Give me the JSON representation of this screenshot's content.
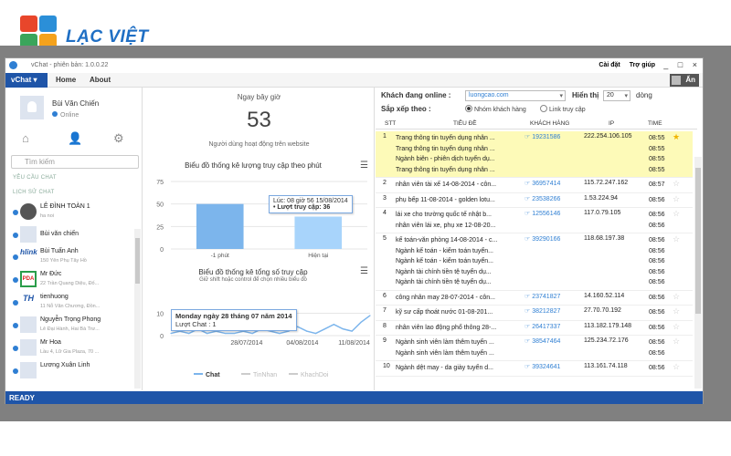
{
  "brand": {
    "logo_text": "LẠC VIỆT"
  },
  "window": {
    "title": "vChat - phiên bản: 1.0.0.22",
    "links": [
      "Cài đặt",
      "Trợ giúp"
    ],
    "controls": [
      "_",
      "□",
      "×"
    ]
  },
  "menu": {
    "vchat": "vChat",
    "items": [
      "Home",
      "About"
    ],
    "right_button": "Ẩn"
  },
  "profile": {
    "name": "Bùi Văn Chiến",
    "status": "Online"
  },
  "search": {
    "placeholder": "Tìm kiếm"
  },
  "sections": {
    "yeu_cau": "YÊU CẦU CHAT",
    "lich_su": "LỊCH SỬ CHAT"
  },
  "contacts": [
    {
      "name": "LÊ ĐÌNH TOÀN 1",
      "sub": "ha noi"
    },
    {
      "name": "Bùi văn chiến",
      "sub": ""
    },
    {
      "name": "Bùi Tuấn Anh",
      "sub": "150 Yên Phụ Tây Hồ"
    },
    {
      "name": "Mr Đức",
      "sub": "22 Trần Quang Diệu, Đố..."
    },
    {
      "name": "tienhuong",
      "sub": "11 Nỗ Văn Chương, Đồn..."
    },
    {
      "name": "Nguyễn Trọng Phong",
      "sub": "Lê Đại Hành, Hai Bà Trư..."
    },
    {
      "name": "Mr Hoa",
      "sub": "Lầu 4, Lữ Gia Plaza, 70 ..."
    },
    {
      "name": "Lương Xuân Linh",
      "sub": ""
    }
  ],
  "stats": {
    "today_label": "Ngay bây giờ",
    "count": "53",
    "count_caption": "Người dùng hoạt động trên website"
  },
  "chart1": {
    "title": "Biểu đồ thống kê lượng truy cập theo phút",
    "tooltip_line1": "Lúc: 08 giờ 56 15/08/2014",
    "tooltip_line2": "• Lượt truy cập: 36"
  },
  "chart2": {
    "title": "Biểu đồ thống kê tổng số truy cập",
    "subtitle": "Giữ shift hoặc control để chọn nhiều biểu đồ",
    "tooltip_line1": "Monday ngày 28 tháng 07 năm 2014",
    "tooltip_line2": "Lượt Chat : 1"
  },
  "chart_data": [
    {
      "type": "bar",
      "title": "Biểu đồ thống kê lượng truy cập theo phút",
      "categories": [
        "-1 phút",
        "Hiện tại"
      ],
      "values": [
        50,
        36
      ],
      "ylim": [
        0,
        75
      ],
      "yticks": [
        0,
        25,
        50,
        75
      ],
      "color": "#7cb5ec"
    },
    {
      "type": "line",
      "title": "Biểu đồ thống kê tổng số truy cập",
      "x_ticks": [
        "28/07/2014",
        "04/08/2014",
        "11/08/2014"
      ],
      "yticks": [
        0,
        10
      ],
      "ylim": [
        0,
        20
      ],
      "series": [
        {
          "name": "Chat",
          "values": [
            1,
            2,
            1,
            3,
            1,
            2,
            1,
            1,
            2,
            1,
            3,
            2,
            1,
            2,
            4,
            2,
            1,
            3,
            5,
            3,
            2,
            6,
            9
          ],
          "color": "#7cb5ec"
        },
        {
          "name": "TinNhan",
          "values": [],
          "color": "#cccccc"
        },
        {
          "name": "KhachDoi",
          "values": [],
          "color": "#cccccc"
        }
      ]
    }
  ],
  "filters": {
    "khach_label": "Khách đang online :",
    "khach_value": "luongcao.com",
    "hien_thi_label": "Hiển thị",
    "hien_thi_value": "20",
    "dong": "dòng",
    "sap_xep_label": "Sắp xếp theo :",
    "opt1": "Nhóm khách hàng",
    "opt2": "Link truy cập"
  },
  "table": {
    "headers": [
      "STT",
      "TIÊU ĐỀ",
      "KHÁCH HÀNG",
      "IP",
      "TIME"
    ],
    "rows": [
      {
        "stt": "1",
        "titles": [
          "Trang thông tin tuyển dụng nhân ...",
          "Trang thông tin tuyển dụng nhân ...",
          "Ngành biên - phiên dịch tuyển dụ...",
          "Trang thông tin tuyển dụng nhân ..."
        ],
        "customer": "19231586",
        "ip": "222.254.106.105",
        "times": [
          "08:55",
          "08:55",
          "08:55",
          "08:55"
        ],
        "starred": true
      },
      {
        "stt": "2",
        "titles": [
          "nhân viên tài xế 14-08-2014 - côn..."
        ],
        "customer": "36957414",
        "ip": "115.72.247.162",
        "times": [
          "08:57"
        ],
        "starred": false
      },
      {
        "stt": "3",
        "titles": [
          "phụ bếp 11-08-2014 - golden lotu..."
        ],
        "customer": "23538266",
        "ip": "1.53.224.94",
        "times": [
          "08:56"
        ],
        "starred": false
      },
      {
        "stt": "4",
        "titles": [
          "lái xe cho trường quốc tế nhật b...",
          "nhân viên lái xe, phụ xe 12-08-20..."
        ],
        "customer": "12556146",
        "ip": "117.0.79.105",
        "times": [
          "08:56",
          "08:56"
        ],
        "starred": false
      },
      {
        "stt": "5",
        "titles": [
          "kế toán-văn phòng 14-08-2014 - c...",
          "Ngành kế toán - kiểm toán tuyển...",
          "Ngành kế toán - kiểm toán tuyển...",
          "Ngành tài chính tiền tệ tuyển dụ...",
          "Ngành tài chính tiền tệ tuyển dụ..."
        ],
        "customer": "39290166",
        "ip": "118.68.197.38",
        "times": [
          "08:56",
          "08:56",
          "08:56",
          "08:56",
          "08:56"
        ],
        "starred": false
      },
      {
        "stt": "6",
        "titles": [
          "công nhân may 28-07-2014 - côn..."
        ],
        "customer": "23741827",
        "ip": "14.160.52.114",
        "times": [
          "08:56"
        ],
        "starred": false
      },
      {
        "stt": "7",
        "titles": [
          "kỹ sư cấp thoát nước 01-08-201..."
        ],
        "customer": "38212827",
        "ip": "27.70.70.192",
        "times": [
          "08:56"
        ],
        "starred": false
      },
      {
        "stt": "8",
        "titles": [
          "nhân viên lao động phổ thông 28-..."
        ],
        "customer": "26417337",
        "ip": "113.182.179.148",
        "times": [
          "08:56"
        ],
        "starred": false
      },
      {
        "stt": "9",
        "titles": [
          "Ngành sinh viên làm thêm tuyển ...",
          "Ngành sinh viên làm thêm tuyển ..."
        ],
        "customer": "38547464",
        "ip": "125.234.72.176",
        "times": [
          "08:56",
          "08:56"
        ],
        "starred": false
      },
      {
        "stt": "10",
        "titles": [
          "Ngành dệt may - da giày tuyển d..."
        ],
        "customer": "39324641",
        "ip": "113.161.74.118",
        "times": [
          "08:56"
        ],
        "starred": false
      }
    ]
  },
  "status": "READY"
}
